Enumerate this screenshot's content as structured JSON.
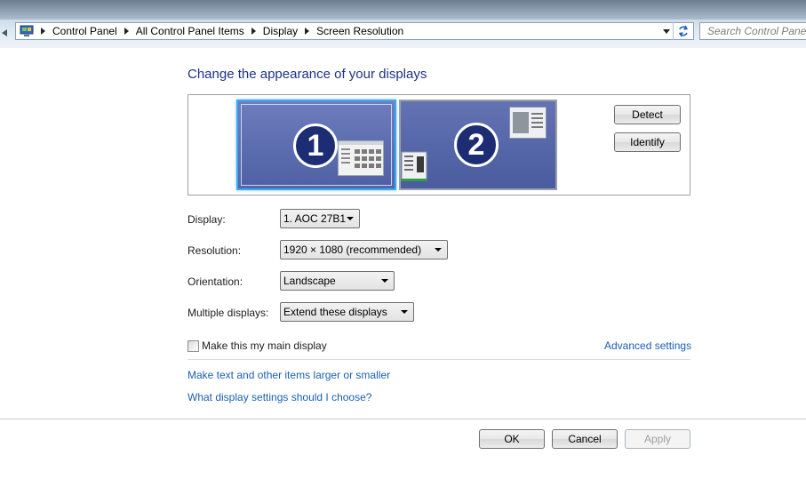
{
  "window": {
    "breadcrumbs": [
      "Control Panel",
      "All Control Panel Items",
      "Display",
      "Screen Resolution"
    ],
    "search_placeholder": "Search Control Panel"
  },
  "page": {
    "title": "Change the appearance of your displays",
    "monitors": [
      {
        "number": "1",
        "selected": true
      },
      {
        "number": "2",
        "selected": false
      }
    ],
    "detect_label": "Detect",
    "identify_label": "Identify"
  },
  "form": {
    "display_label": "Display:",
    "display_value": "1. AOC 27B1",
    "resolution_label": "Resolution:",
    "resolution_value": "1920 × 1080 (recommended)",
    "orientation_label": "Orientation:",
    "orientation_value": "Landscape",
    "multiple_label": "Multiple displays:",
    "multiple_value": "Extend these displays",
    "main_display_label": "Make this my main display",
    "main_display_checked": false,
    "advanced_link": "Advanced settings"
  },
  "links": {
    "text_size": "Make text and other items larger or smaller",
    "which_settings": "What display settings should I choose?"
  },
  "footer": {
    "ok_label": "OK",
    "cancel_label": "Cancel",
    "apply_label": "Apply",
    "apply_enabled": false
  },
  "colors": {
    "title": "#1e3287",
    "link": "#1a5fb4",
    "monitor_selected_border": "#3ba8f2"
  }
}
